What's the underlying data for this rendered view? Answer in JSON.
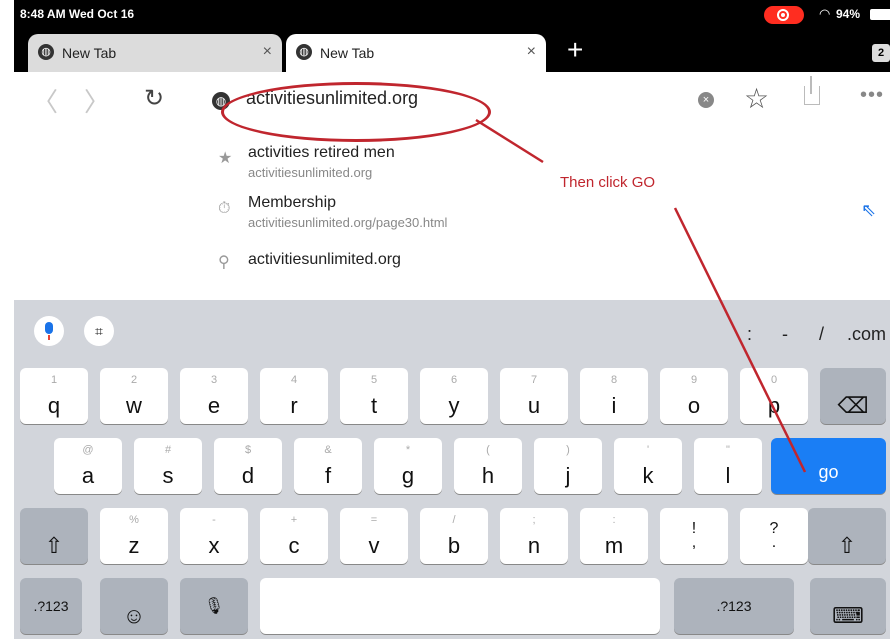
{
  "status": {
    "time": "8:48 AM  Wed Oct 16",
    "battery": "94%"
  },
  "tabs": [
    {
      "title": "New Tab",
      "close": "×"
    },
    {
      "title": "New Tab",
      "close": "×"
    }
  ],
  "tab_count": "2",
  "toolbar": {
    "back": "〈",
    "forward": "〉",
    "reload": "↻",
    "url": "activitiesunlimited.org",
    "clear": "×",
    "bookmark": "☆",
    "more": "•••"
  },
  "suggestions": [
    {
      "icon": "★",
      "text": "activities retired men",
      "sub": "activitiesunlimited.org"
    },
    {
      "icon": "⏱",
      "text": "Membership",
      "sub": "activitiesunlimited.org/page30.html"
    },
    {
      "icon": "⚲",
      "text": "activitiesunlimited.org",
      "sub": ""
    }
  ],
  "annotation": {
    "text": "Then click GO",
    "color": "#c0262e"
  },
  "keyboard": {
    "symbols": [
      ":",
      "-",
      "/",
      ".com"
    ],
    "row1": [
      {
        "sec": "1",
        "pri": "q"
      },
      {
        "sec": "2",
        "pri": "w"
      },
      {
        "sec": "3",
        "pri": "e"
      },
      {
        "sec": "4",
        "pri": "r"
      },
      {
        "sec": "5",
        "pri": "t"
      },
      {
        "sec": "6",
        "pri": "y"
      },
      {
        "sec": "7",
        "pri": "u"
      },
      {
        "sec": "8",
        "pri": "i"
      },
      {
        "sec": "9",
        "pri": "o"
      },
      {
        "sec": "0",
        "pri": "p"
      }
    ],
    "row2": [
      {
        "sec": "@",
        "pri": "a"
      },
      {
        "sec": "#",
        "pri": "s"
      },
      {
        "sec": "$",
        "pri": "d"
      },
      {
        "sec": "&",
        "pri": "f"
      },
      {
        "sec": "*",
        "pri": "g"
      },
      {
        "sec": "(",
        "pri": "h"
      },
      {
        "sec": ")",
        "pri": "j"
      },
      {
        "sec": "'",
        "pri": "k"
      },
      {
        "sec": "\"",
        "pri": "l"
      }
    ],
    "row3": [
      {
        "sec": "%",
        "pri": "z"
      },
      {
        "sec": "-",
        "pri": "x"
      },
      {
        "sec": "+",
        "pri": "c"
      },
      {
        "sec": "=",
        "pri": "v"
      },
      {
        "sec": "/",
        "pri": "b"
      },
      {
        "sec": ";",
        "pri": "n"
      },
      {
        "sec": ":",
        "pri": "m"
      },
      {
        "sec": "",
        "pri": "!\n,"
      },
      {
        "sec": "",
        "pri": "?\n."
      }
    ],
    "backspace": "⌫",
    "go": "go",
    "shift": "⇧",
    "num_left": ".?123",
    "num_right": ".?123",
    "emoji": "☺",
    "dictation": "🎙",
    "hide": "⌨"
  },
  "colors": {
    "accent": "#1a7ef5",
    "annotation": "#c0262e"
  }
}
